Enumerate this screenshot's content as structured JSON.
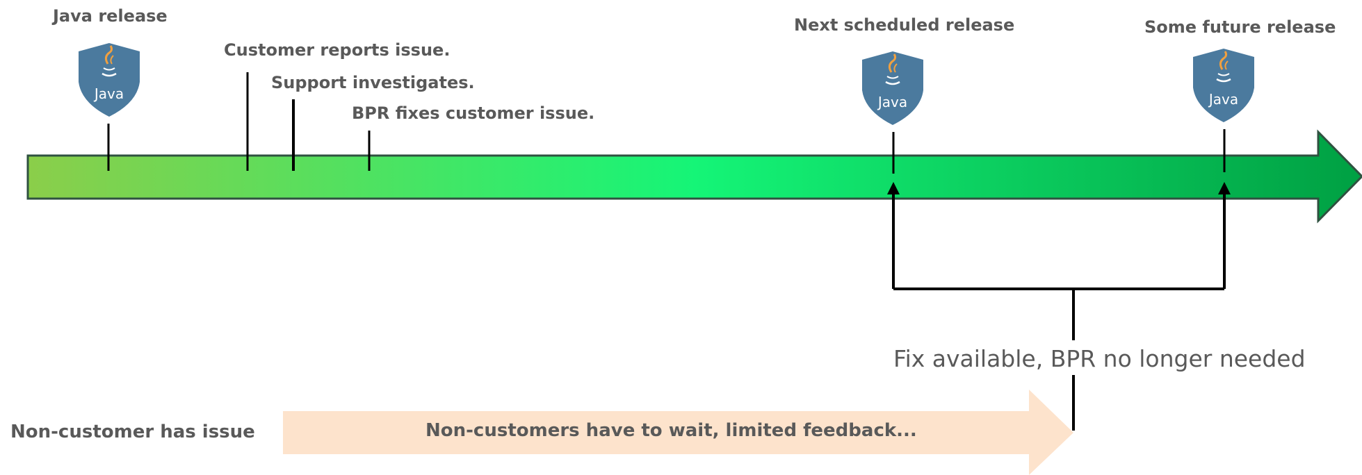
{
  "timeline": {
    "events": [
      {
        "id": "java-release",
        "label": "Java release"
      },
      {
        "id": "customer-reports",
        "label": "Customer reports issue."
      },
      {
        "id": "support-investigates",
        "label": "Support investigates."
      },
      {
        "id": "bpr-fixes",
        "label": "BPR fixes customer issue."
      },
      {
        "id": "next-release",
        "label": "Next scheduled release"
      },
      {
        "id": "future-release",
        "label": "Some future release"
      }
    ],
    "badge_text": "Java",
    "fix_note": "Fix available, BPR no longer needed"
  },
  "non_customer": {
    "label": "Non-customer has issue",
    "arrow_text": "Non-customers have to wait, limited feedback..."
  },
  "colors": {
    "timeline_start": "#8bce4a",
    "timeline_mid": "#15f577",
    "timeline_end": "#00a043",
    "badge": "#4b7a9e",
    "peach_arrow": "#fde3cc",
    "label_text": "#595959"
  }
}
